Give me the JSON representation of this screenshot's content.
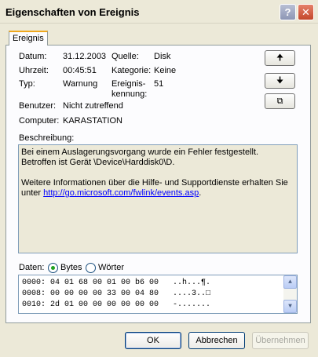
{
  "window": {
    "title": "Eigenschaften von Ereignis",
    "help_label": "?",
    "close_label": "✕"
  },
  "tabs": [
    {
      "label": "Ereignis"
    }
  ],
  "fields": {
    "datum_label": "Datum:",
    "datum_value": "31.12.2003",
    "quelle_label": "Quelle:",
    "quelle_value": "Disk",
    "uhrzeit_label": "Uhrzeit:",
    "uhrzeit_value": "00:45:51",
    "kategorie_label": "Kategorie:",
    "kategorie_value": "Keine",
    "typ_label": "Typ:",
    "typ_value": "Warnung",
    "kennung_label_1": "Ereignis-",
    "kennung_label_2": "kennung:",
    "kennung_value": "51",
    "benutzer_label": "Benutzer:",
    "benutzer_value": "Nicht zutreffend",
    "computer_label": "Computer:",
    "computer_value": "KARASTATION"
  },
  "nav_buttons": {
    "up": "🠉",
    "down": "🠋",
    "copy": "⧉"
  },
  "description": {
    "label": "Beschreibung:",
    "line1": "Bei einem Auslagerungsvorgang wurde ein Fehler festgestellt. Betroffen ist Gerät \\Device\\Harddisk0\\D.",
    "line2": "Weitere Informationen über die Hilfe- und Supportdienste erhalten Sie unter",
    "link": "http://go.microsoft.com/fwlink/events.asp",
    "link_suffix": "."
  },
  "data_section": {
    "label": "Daten:",
    "bytes_label": "Bytes",
    "words_label": "Wörter",
    "selected": "Bytes",
    "lines": [
      "0000: 04 01 68 00 01 00 b6 00   ..h...¶.",
      "0008: 00 00 00 00 33 00 04 80   ....3..□",
      "0010: 2d 01 00 00 00 00 00 00   -......."
    ]
  },
  "buttons": {
    "ok": "OK",
    "cancel": "Abbrechen",
    "apply": "Übernehmen"
  }
}
